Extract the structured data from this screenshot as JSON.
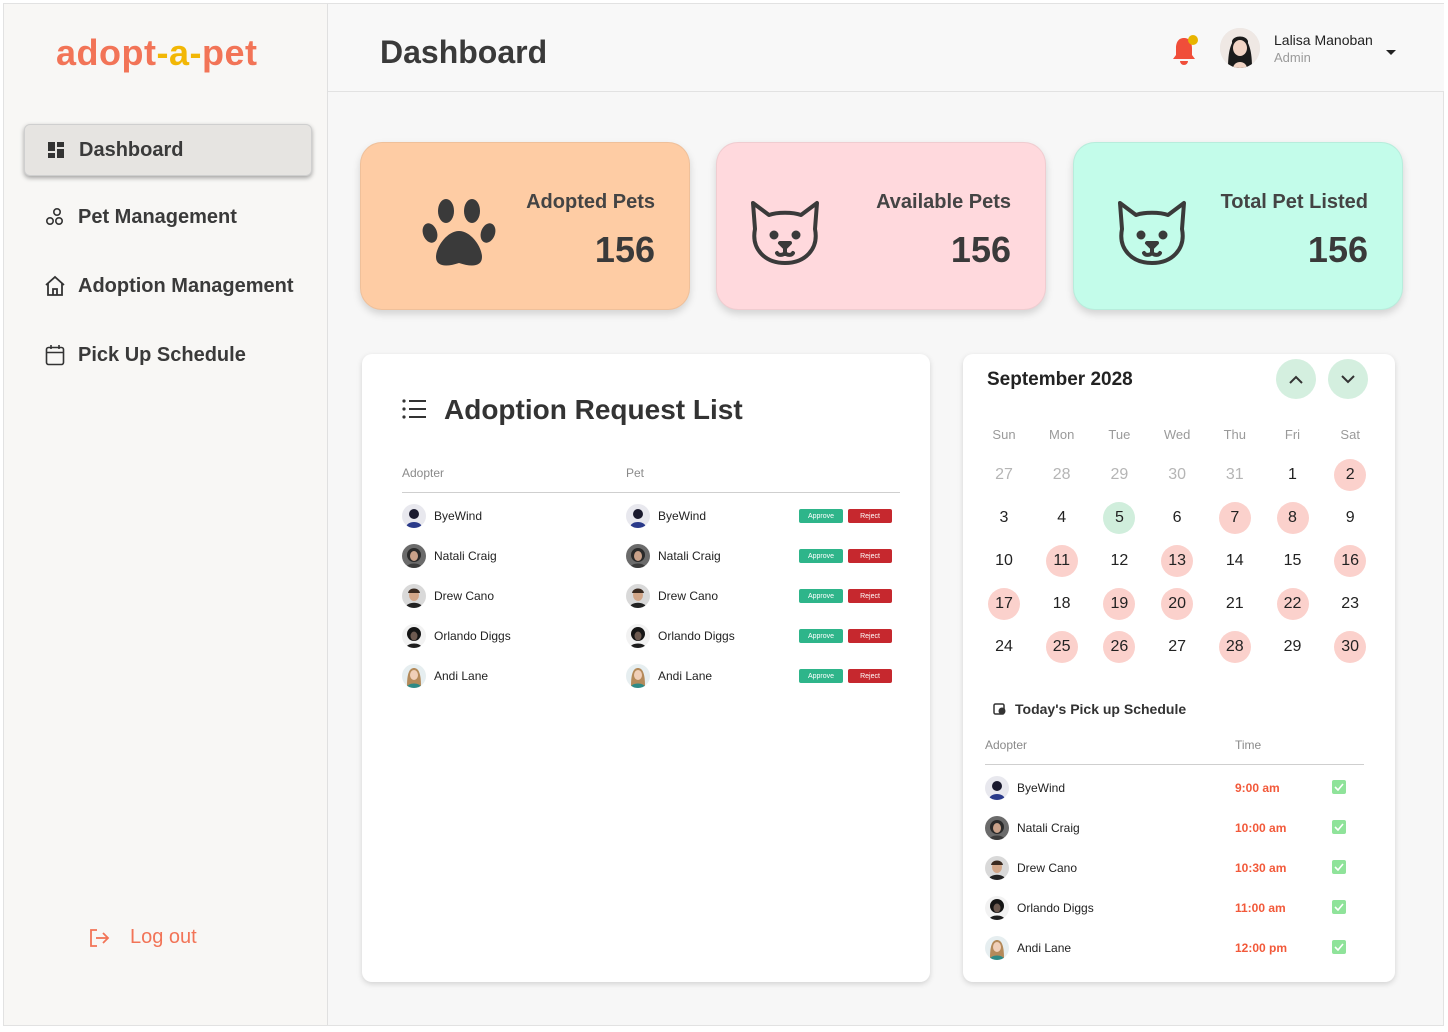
{
  "brand": {
    "part1": "adopt",
    "part2": "-a-",
    "part3": "pet"
  },
  "sidebar": {
    "items": [
      {
        "label": "Dashboard",
        "icon": "dashboard-icon"
      },
      {
        "label": "Pet Management",
        "icon": "pets-cluster-icon"
      },
      {
        "label": "Adoption Management",
        "icon": "home-icon"
      },
      {
        "label": "Pick Up Schedule",
        "icon": "calendar-icon"
      }
    ],
    "logout": "Log out"
  },
  "header": {
    "title": "Dashboard",
    "user": {
      "name": "Lalisa Manoban",
      "role": "Admin"
    }
  },
  "stats": [
    {
      "label": "Adopted Pets",
      "value": "156",
      "icon": "paw-icon",
      "color": "#fecca4"
    },
    {
      "label": "Available Pets",
      "value": "156",
      "icon": "cat-face-icon",
      "color": "#ffd9dd"
    },
    {
      "label": "Total Pet Listed",
      "value": "156",
      "icon": "cat-face-icon",
      "color": "#c3fcea"
    }
  ],
  "adoption_list": {
    "title": "Adoption Request List",
    "columns": {
      "adopter": "Adopter",
      "pet": "Pet"
    },
    "approve_label": "Approve",
    "reject_label": "Reject",
    "rows": [
      {
        "adopter": "ByeWind",
        "pet": "ByeWind"
      },
      {
        "adopter": "Natali Craig",
        "pet": "Natali Craig"
      },
      {
        "adopter": "Drew Cano",
        "pet": "Drew Cano"
      },
      {
        "adopter": "Orlando Diggs",
        "pet": "Orlando Diggs"
      },
      {
        "adopter": "Andi Lane",
        "pet": "Andi Lane"
      }
    ]
  },
  "calendar": {
    "month_label": "September 2028",
    "weekdays": [
      "Sun",
      "Mon",
      "Tue",
      "Wed",
      "Thu",
      "Fri",
      "Sat"
    ],
    "weeks": [
      [
        "27",
        "28",
        "29",
        "30",
        "31",
        "1",
        "2"
      ],
      [
        "3",
        "4",
        "5",
        "6",
        "7",
        "8",
        "9"
      ],
      [
        "10",
        "11",
        "12",
        "13",
        "14",
        "15",
        "16"
      ],
      [
        "17",
        "18",
        "19",
        "20",
        "21",
        "22",
        "23"
      ],
      [
        "24",
        "25",
        "26",
        "27",
        "28",
        "29",
        "30"
      ]
    ],
    "outside_month_days": [
      "27",
      "28",
      "29",
      "30",
      "31"
    ],
    "highlighted_days": [
      "2",
      "7",
      "8",
      "11",
      "13",
      "16",
      "17",
      "19",
      "20",
      "22",
      "25",
      "26",
      "28",
      "30"
    ],
    "today": "5",
    "highlight_color": "#fbd1cc",
    "today_color": "#d0eedc"
  },
  "schedule": {
    "title": "Today's Pick up Schedule",
    "columns": {
      "adopter": "Adopter",
      "time": "Time"
    },
    "rows": [
      {
        "adopter": "ByeWind",
        "time": "9:00 am",
        "done": true
      },
      {
        "adopter": "Natali Craig",
        "time": "10:00 am",
        "done": true
      },
      {
        "adopter": "Drew Cano",
        "time": "10:30 am",
        "done": true
      },
      {
        "adopter": "Orlando Diggs",
        "time": "11:00 am",
        "done": true
      },
      {
        "adopter": "Andi Lane",
        "time": "12:00 pm",
        "done": true
      }
    ]
  }
}
